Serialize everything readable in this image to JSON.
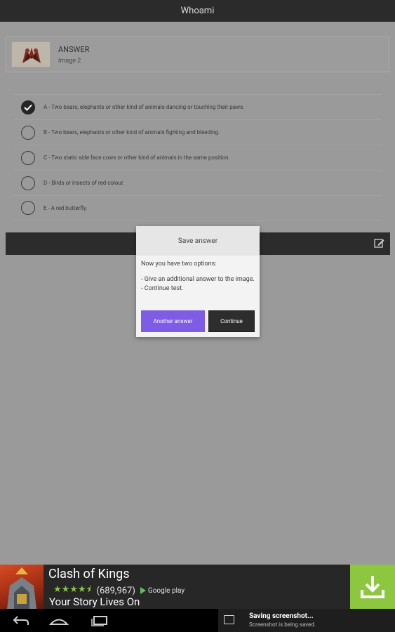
{
  "app": {
    "title": "Whoami"
  },
  "answer": {
    "title": "ANSWER",
    "subtitle": "Image 2"
  },
  "options": [
    {
      "label": "A - Two bears, elephants or other kind of animals dancing or touching their paws.",
      "checked": true
    },
    {
      "label": "B - Two bears, elephants or other kind of animals fighting and bleeding.",
      "checked": false
    },
    {
      "label": "C - Two static side face cows or other kind of animals in the same position.",
      "checked": false
    },
    {
      "label": "D - Birds or insects of red colour.",
      "checked": false
    },
    {
      "label": "E - A red butterfly.",
      "checked": false
    }
  ],
  "dialog": {
    "title": "Save answer",
    "intro": "Now you have two options:",
    "line1": "- Give an additional answer to the image.",
    "line2": "- Continue test.",
    "btn_another": "Another answer",
    "btn_continue": "Continue"
  },
  "ad": {
    "title": "Clash of Kings",
    "stars": "★★★★⯨",
    "reviews": "(689,967)",
    "store": "Google play",
    "tagline": "Your Story Lives On"
  },
  "notification": {
    "title": "Saving screenshot...",
    "subtitle": "Screenshot is being saved."
  },
  "colors": {
    "accent": "#7e5ce6",
    "ad_download": "#8dc63f",
    "titlebar": "#2b2b2b"
  }
}
